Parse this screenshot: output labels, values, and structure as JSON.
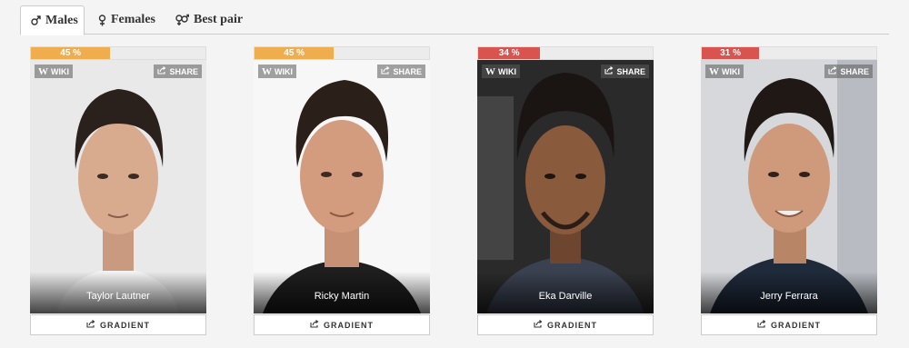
{
  "tabs": [
    {
      "label": "Males",
      "icon": "male-icon",
      "active": true
    },
    {
      "label": "Females",
      "icon": "female-icon",
      "active": false
    },
    {
      "label": "Best pair",
      "icon": "pair-icon",
      "active": false
    }
  ],
  "card_labels": {
    "wiki": "WIKI",
    "share": "SHARE",
    "gradient": "GRADIENT"
  },
  "cards": [
    {
      "name": "Taylor Lautner",
      "percent_text": "45 %",
      "percent": 45,
      "bar_color": "#f0ad4e"
    },
    {
      "name": "Ricky Martin",
      "percent_text": "45 %",
      "percent": 45,
      "bar_color": "#f0ad4e"
    },
    {
      "name": "Eka Darville",
      "percent_text": "34 %",
      "percent": 34,
      "bar_color": "#d9534f"
    },
    {
      "name": "Jerry Ferrara",
      "percent_text": "31 %",
      "percent": 31,
      "bar_color": "#d9534f"
    }
  ]
}
